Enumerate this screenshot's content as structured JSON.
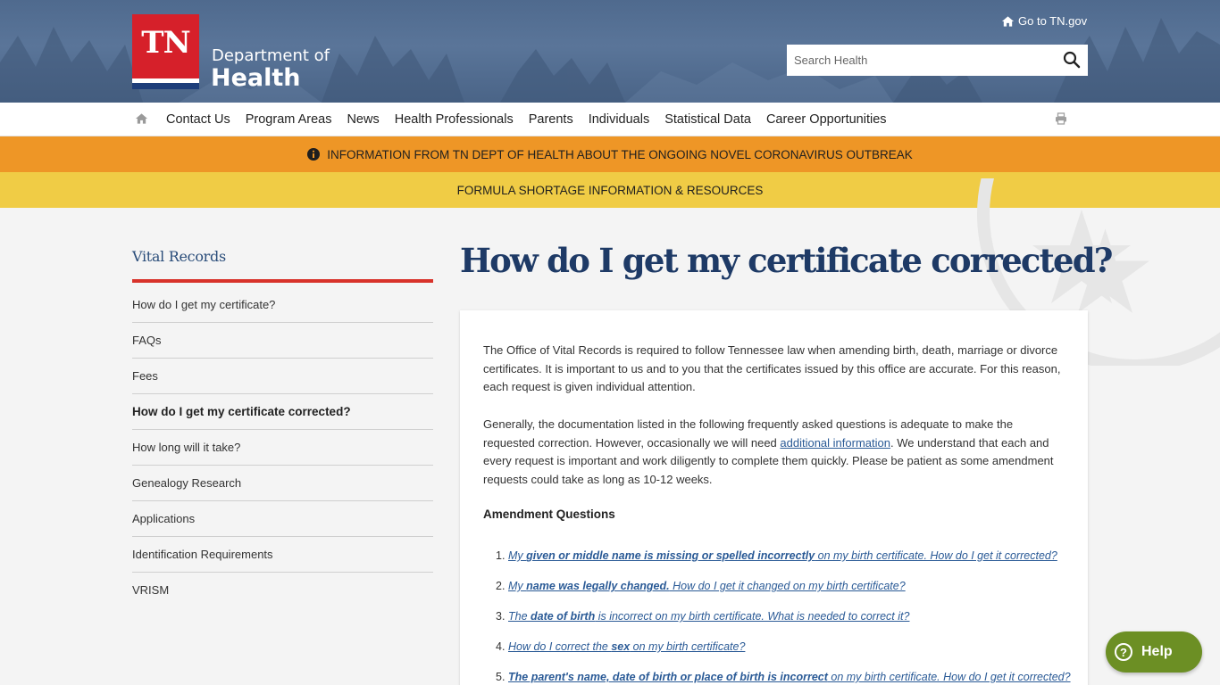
{
  "header": {
    "logo_text": "TN",
    "dept_line1": "Department of",
    "dept_line2": "Health",
    "goto_link": "Go to TN.gov",
    "search_placeholder": "Search Health"
  },
  "nav": {
    "items": [
      "Contact Us",
      "Program Areas",
      "News",
      "Health Professionals",
      "Parents",
      "Individuals",
      "Statistical Data",
      "Career Opportunities"
    ]
  },
  "banners": {
    "covid": "INFORMATION FROM TN DEPT OF HEALTH ABOUT THE ONGOING NOVEL CORONAVIRUS OUTBREAK",
    "formula": "FORMULA SHORTAGE INFORMATION & RESOURCES"
  },
  "sidebar": {
    "title": "Vital Records",
    "items": [
      "How do I get my certificate?",
      "FAQs",
      "Fees",
      "How do I get my certificate corrected?",
      "How long will it take?",
      "Genealogy Research",
      "Applications",
      "Identification Requirements",
      "VRISM"
    ]
  },
  "main": {
    "title": "How do I get my certificate corrected?",
    "para1": "The Office of Vital Records is required to follow Tennessee law when amending birth, death, marriage or divorce certificates. It is important to us and to you that the certificates issued by this office are accurate.  For this reason, each request is given individual attention.",
    "para2_before": "Generally, the documentation listed in the following frequently asked questions is adequate to make the requested correction. However, occasionally we will need ",
    "para2_link": "additional information",
    "para2_after": ".   We understand that each and every request is important and work diligently to complete them quickly.  Please be patient as some amendment requests could take as long as 10-12 weeks.",
    "amendment_heading": "Amendment Questions",
    "questions": [
      {
        "num": "1.",
        "pre": "My ",
        "bold": "given or middle name is missing or spelled incorrectly",
        "post": " on my birth certificate.  How do I get it corrected?"
      },
      {
        "num": "2.",
        "pre": "My ",
        "bold": "name was legally changed.",
        "post": " How do I get it changed on my birth certificate?"
      },
      {
        "num": "3.",
        "pre": "The ",
        "bold": "date of birth",
        "post": " is incorrect on my birth certificate.  What is needed to correct it?"
      },
      {
        "num": "4.",
        "pre": "How do I correct the ",
        "bold": "sex",
        "post": " on my birth certificate?"
      },
      {
        "num": "5.",
        "pre": "",
        "bold": "The parent's name, date of birth or place of birth is incorrect",
        "post": " on my birth certificate.  How do I get it corrected?"
      }
    ]
  },
  "help": {
    "label": "Help"
  },
  "colors": {
    "header_bg": "#566f93",
    "logo_red": "#d6202a",
    "banner_orange": "#ee9626",
    "banner_yellow": "#f0cc45",
    "sidebar_accent": "#d8322a",
    "title_navy": "#1e3a66",
    "link_blue": "#2a5a96",
    "help_green": "#6c8f24"
  }
}
